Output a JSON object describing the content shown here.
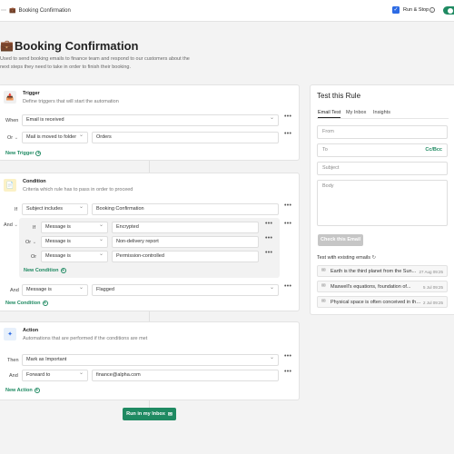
{
  "topbar": {
    "title": "Booking Confirmation",
    "run_stop_label": "Run & Stop",
    "run_stop_checked": true,
    "toggle_on": true
  },
  "page": {
    "title": "Booking Confirmation",
    "description": "Used to send booking emails to finance team and respond to our customers about the next steps they need to take in order to finish their booking."
  },
  "trigger": {
    "title": "Trigger",
    "subtitle": "Define triggers that will start the automation",
    "rows": [
      {
        "prefix": "When",
        "condition": "Email is received"
      },
      {
        "prefix": "Or",
        "condition": "Mail is moved to folder",
        "value": "Orders"
      }
    ],
    "add_label": "New Trigger"
  },
  "condition": {
    "title": "Condition",
    "subtitle": "Criteria which rule has to pass in order to proceed",
    "first": {
      "prefix": "If",
      "field": "Subject includes",
      "value": "Booking Confirmation"
    },
    "group_prefix": "And",
    "group": [
      {
        "prefix": "If",
        "field": "Message is",
        "value": "Encrypted"
      },
      {
        "prefix": "Or",
        "field": "Message is",
        "value": "Non-delivery report"
      },
      {
        "prefix": "Or",
        "field": "Message is",
        "value": "Permission-controlled"
      }
    ],
    "group_add_label": "New Condition",
    "last": {
      "prefix": "And",
      "field": "Message is",
      "value": "Flagged"
    },
    "add_label": "New Condition"
  },
  "action": {
    "title": "Action",
    "subtitle": "Automations that are performed if the conditions are met",
    "rows": [
      {
        "prefix": "Then",
        "action": "Mark as Important"
      },
      {
        "prefix": "And",
        "action": "Forward to",
        "value": "finance@alpha.com"
      }
    ],
    "add_label": "New Action"
  },
  "run_button_label": "Run in my Inbox",
  "test_panel": {
    "title": "Test this Rule",
    "tabs": [
      "Email Test",
      "My Inbox",
      "Insights"
    ],
    "from_placeholder": "From",
    "to_placeholder": "To",
    "cc_label": "Cc/Bcc",
    "subject_placeholder": "Subject",
    "body_placeholder": "Body",
    "check_button_label": "Check this Email",
    "existing_title": "Test with existing emails",
    "emails": [
      {
        "title": "Earth is the third planet from the Sun...",
        "date": "27 Aug 09:25"
      },
      {
        "title": "Maxwell's equations, foundation of...",
        "date": "5 Jul 09:25"
      },
      {
        "title": "Physical space is often conceived in thre...",
        "date": "2 Jul 09:25"
      }
    ]
  },
  "icons": {
    "trigger": "inbox-icon",
    "condition": "document-icon",
    "action": "sparkle-icon"
  },
  "colors": {
    "accent": "#1f8a62",
    "checkbox": "#2d6be4"
  }
}
